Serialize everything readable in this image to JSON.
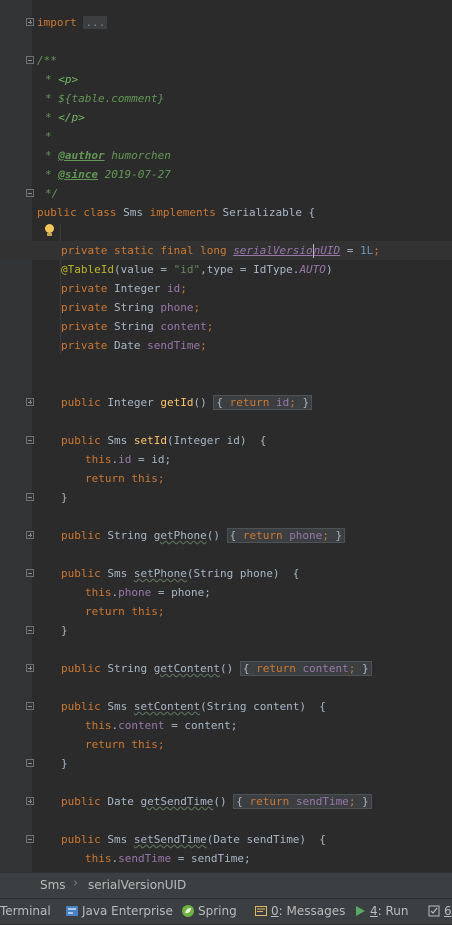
{
  "editor": {
    "lines": {
      "import": {
        "kw": "import",
        "dots": "..."
      },
      "c1": "/**",
      "c2": {
        "star": "* ",
        "tag": "<p>"
      },
      "c3": {
        "star": "* ",
        "text": "${table.comment}"
      },
      "c4": {
        "star": "* ",
        "tag": "</p>"
      },
      "c5": "*",
      "c6": {
        "star": "* ",
        "tag": "@author",
        "text": " humorchen"
      },
      "c7": {
        "star": "* ",
        "tag": "@since",
        "text": " 2019-07-27"
      },
      "c8": "*/",
      "classDecl": {
        "kw1": "public class",
        "name": " Sms ",
        "kw2": "implements",
        "iface": " Serializable {"
      },
      "serial": {
        "kw": "private static final long ",
        "fld_a": "serialVersio",
        "fld_b": "nUID",
        "eq": " = ",
        "num": "1L",
        "end": ";"
      },
      "tableId": {
        "ann": "@TableId",
        "p1": "(value = ",
        "str": "\"id\"",
        "p2": ",type = IdType.",
        "const": "AUTO",
        "p3": ")"
      },
      "f1": {
        "kw": "private ",
        "type": "Integer ",
        "name": "id",
        "end": ";"
      },
      "f2": {
        "kw": "private ",
        "type": "String ",
        "name": "phone",
        "end": ";"
      },
      "f3": {
        "kw": "private ",
        "type": "String ",
        "name": "content",
        "end": ";"
      },
      "f4": {
        "kw": "private ",
        "type": "Date ",
        "name": "sendTime",
        "end": ";"
      },
      "getId": {
        "kw": "public ",
        "type": "Integer ",
        "name": "getId",
        "paren": "()",
        "ret": "return ",
        "field": "id",
        "end": ";"
      },
      "setId": {
        "kw": "public ",
        "type": "Sms ",
        "name": "setId",
        "params": "(Integer id)  {"
      },
      "setIdB1": {
        "kw": "this",
        "dot": ".",
        "fld": "id",
        "rest": " = id;"
      },
      "ret1": {
        "kw": "return this",
        "end": ";"
      },
      "close1": "}",
      "getPhone": {
        "kw": "public ",
        "type": "String ",
        "name": "getPhone",
        "paren": "()",
        "ret": "return ",
        "field": "phone",
        "end": ";"
      },
      "setPhone": {
        "kw": "public ",
        "type": "Sms ",
        "name": "setPhone",
        "params": "(String phone)  {"
      },
      "setPhoneB1": {
        "kw": "this",
        "dot": ".",
        "fld": "phone",
        "rest": " = phone;"
      },
      "ret2": {
        "kw": "return this",
        "end": ";"
      },
      "close2": "}",
      "getContent": {
        "kw": "public ",
        "type": "String ",
        "name": "getContent",
        "paren": "()",
        "ret": "return ",
        "field": "content",
        "end": ";"
      },
      "setContent": {
        "kw": "public ",
        "type": "Sms ",
        "name": "setContent",
        "params": "(String content)  {"
      },
      "setContentB1": {
        "kw": "this",
        "dot": ".",
        "fld": "content",
        "rest": " = content;"
      },
      "ret3": {
        "kw": "return this",
        "end": ";"
      },
      "close3": "}",
      "getSendTime": {
        "kw": "public ",
        "type": "Date ",
        "name": "getSendTime",
        "paren": "()",
        "ret": "return ",
        "field": "sendTime",
        "end": ";"
      },
      "setSendTime": {
        "kw": "public ",
        "type": "Sms ",
        "name": "setSendTime",
        "params": "(Date sendTime)  {"
      },
      "setSendTimeB1": {
        "kw": "this",
        "dot": ".",
        "fld": "sendTime",
        "rest": " = sendTime;"
      }
    }
  },
  "breadcrumb": {
    "class": "Sms",
    "member": "serialVersionUID"
  },
  "toolbar": {
    "terminal": "Terminal",
    "javaEnterprise": "Java Enterprise",
    "spring": "Spring",
    "messages_num": "0",
    "messages_label": ": Messages",
    "run_num": "4",
    "run_label": ": Run",
    "todo_num": "6"
  },
  "colors": {
    "keyword": "#cc7832",
    "field": "#9876aa",
    "method": "#ffc66d",
    "annotation": "#bbb529",
    "string": "#6a8759",
    "number": "#6897bb",
    "comment": "#629755",
    "bulb": "#f2c55c"
  }
}
